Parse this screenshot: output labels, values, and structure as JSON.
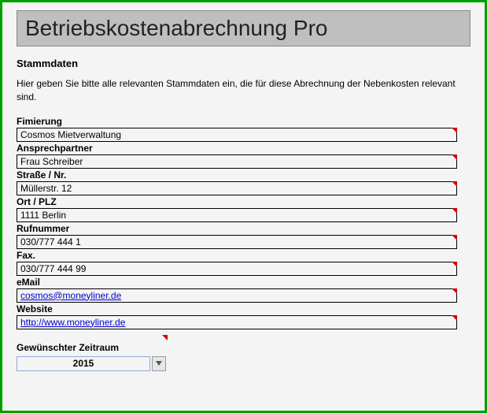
{
  "title": "Betriebskostenabrechnung Pro",
  "section_title": "Stammdaten",
  "intro": "Hier geben Sie bitte alle relevanten Stammdaten ein, die für diese Abrechnung der Nebenkosten relevant sind.",
  "fields": {
    "fimierung": {
      "label": "Fimierung",
      "value": "Cosmos Mietverwaltung"
    },
    "ansprechpartner": {
      "label": "Ansprechpartner",
      "value": "Frau Schreiber"
    },
    "strasse": {
      "label": "Straße / Nr.",
      "value": "Müllerstr. 12"
    },
    "ort": {
      "label": "Ort / PLZ",
      "value": "1111 Berlin"
    },
    "rufnummer": {
      "label": "Rufnummer",
      "value": "030/777 444 1"
    },
    "fax": {
      "label": "Fax.",
      "value": "030/777 444 99"
    },
    "email": {
      "label": "eMail",
      "value": "cosmos@moneyliner.de"
    },
    "website": {
      "label": "Website",
      "value": "http://www.moneyliner.de"
    }
  },
  "period": {
    "label": "Gewünschter Zeitraum",
    "value": "2015"
  }
}
